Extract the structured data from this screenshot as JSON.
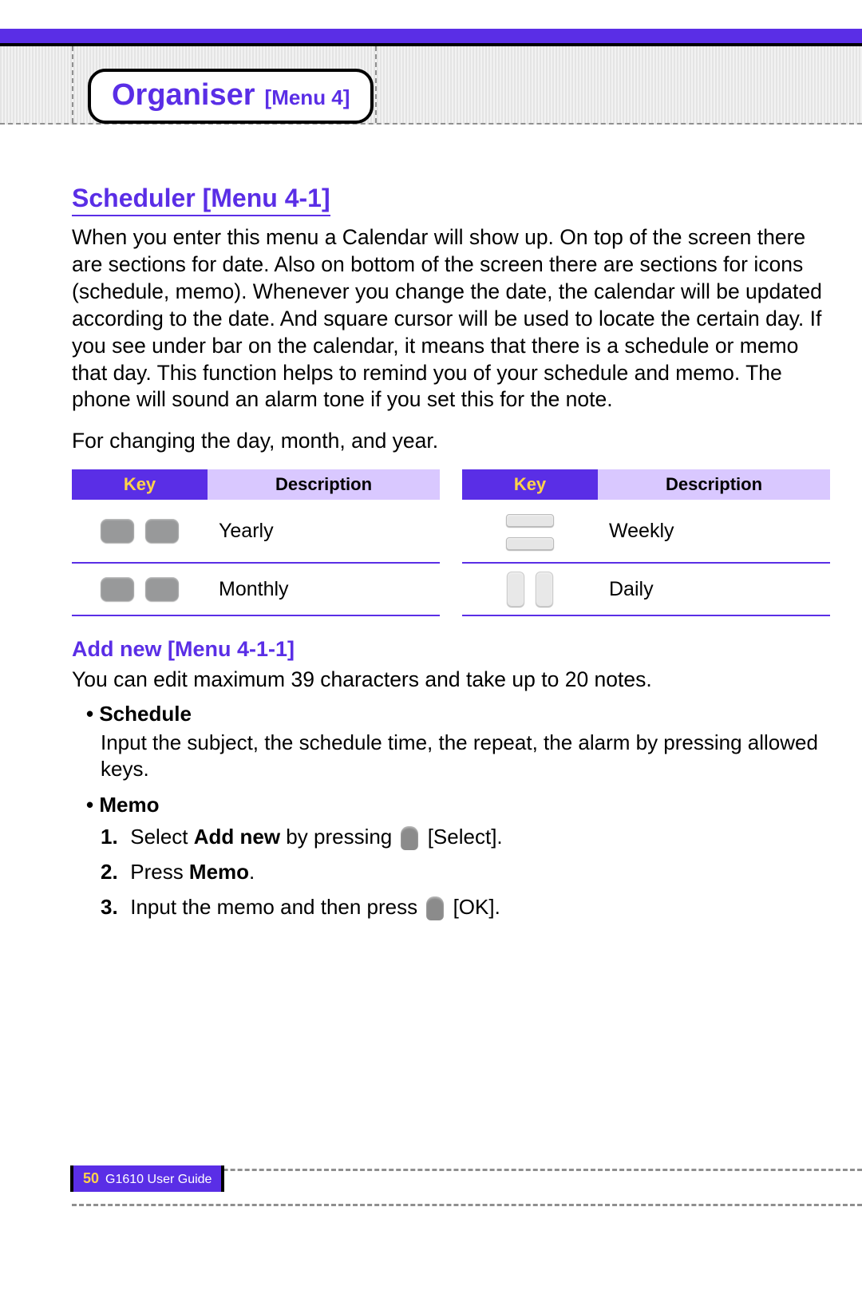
{
  "chapter": {
    "title": "Organiser",
    "menu": "[Menu 4]"
  },
  "section": {
    "heading": "Scheduler [Menu 4-1]"
  },
  "para1": "When you enter this menu a Calendar will show up. On top of the screen there are sections for date. Also on bottom of the screen there are sections for icons (schedule, memo). Whenever you change the date, the calendar will be updated according to the date. And square cursor will be used to locate the certain day. If you see under bar on the calendar, it means that there is a schedule or memo that day. This function helps to remind you of your schedule and memo. The phone will sound an alarm tone if you set this for the note.",
  "para2": "For changing the day, month, and year.",
  "table": {
    "headers": {
      "key": "Key",
      "desc": "Description"
    },
    "rows": [
      {
        "key_icon": "num-keys-1-3",
        "desc": "Yearly",
        "key_icon_r": "nav-top-bottom",
        "desc_r": "Weekly"
      },
      {
        "key_icon": "num-keys-star-hash",
        "desc": "Monthly",
        "key_icon_r": "nav-up-down",
        "desc_r": "Daily"
      }
    ]
  },
  "subsection": {
    "heading": "Add new [Menu 4-1-1]"
  },
  "sub_para": "You can edit maximum 39 characters and take up to 20 notes.",
  "bullet_schedule": {
    "label": "Schedule",
    "text": "Input the subject, the schedule time, the repeat, the alarm by pressing allowed keys."
  },
  "bullet_memo": {
    "label": "Memo"
  },
  "steps": [
    {
      "num": "1.",
      "pre": "Select ",
      "bold": "Add new",
      "post": " by pressing ",
      "suffix": " [Select]."
    },
    {
      "num": "2.",
      "pre": "Press ",
      "bold": "Memo",
      "post": ".",
      "suffix": ""
    },
    {
      "num": "3.",
      "pre": "Input the memo and then press ",
      "bold": "",
      "post": "",
      "suffix": " [OK]."
    }
  ],
  "footer": {
    "page": "50",
    "guide": "G1610 User Guide"
  }
}
